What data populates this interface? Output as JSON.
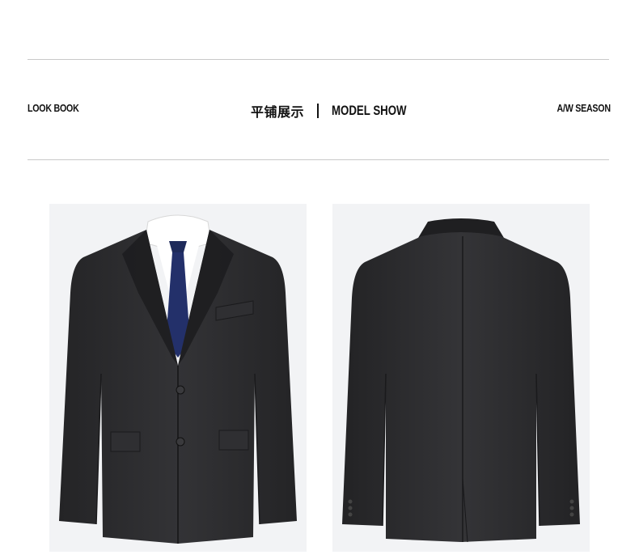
{
  "header": {
    "left_label": "LOOK BOOK",
    "center_cn": "平铺展示",
    "center_en": "MODEL SHOW",
    "right_label": "A/W SEASON"
  },
  "photos": [
    {
      "name": "suit-front",
      "alt": "jacket front view"
    },
    {
      "name": "suit-back",
      "alt": "jacket back view"
    }
  ],
  "colors": {
    "jacket": "#2b2b2d",
    "tie": "#1e2a5a",
    "shirt": "#ffffff",
    "photo_bg": "#f2f3f5",
    "rule": "#c9c9c9"
  }
}
